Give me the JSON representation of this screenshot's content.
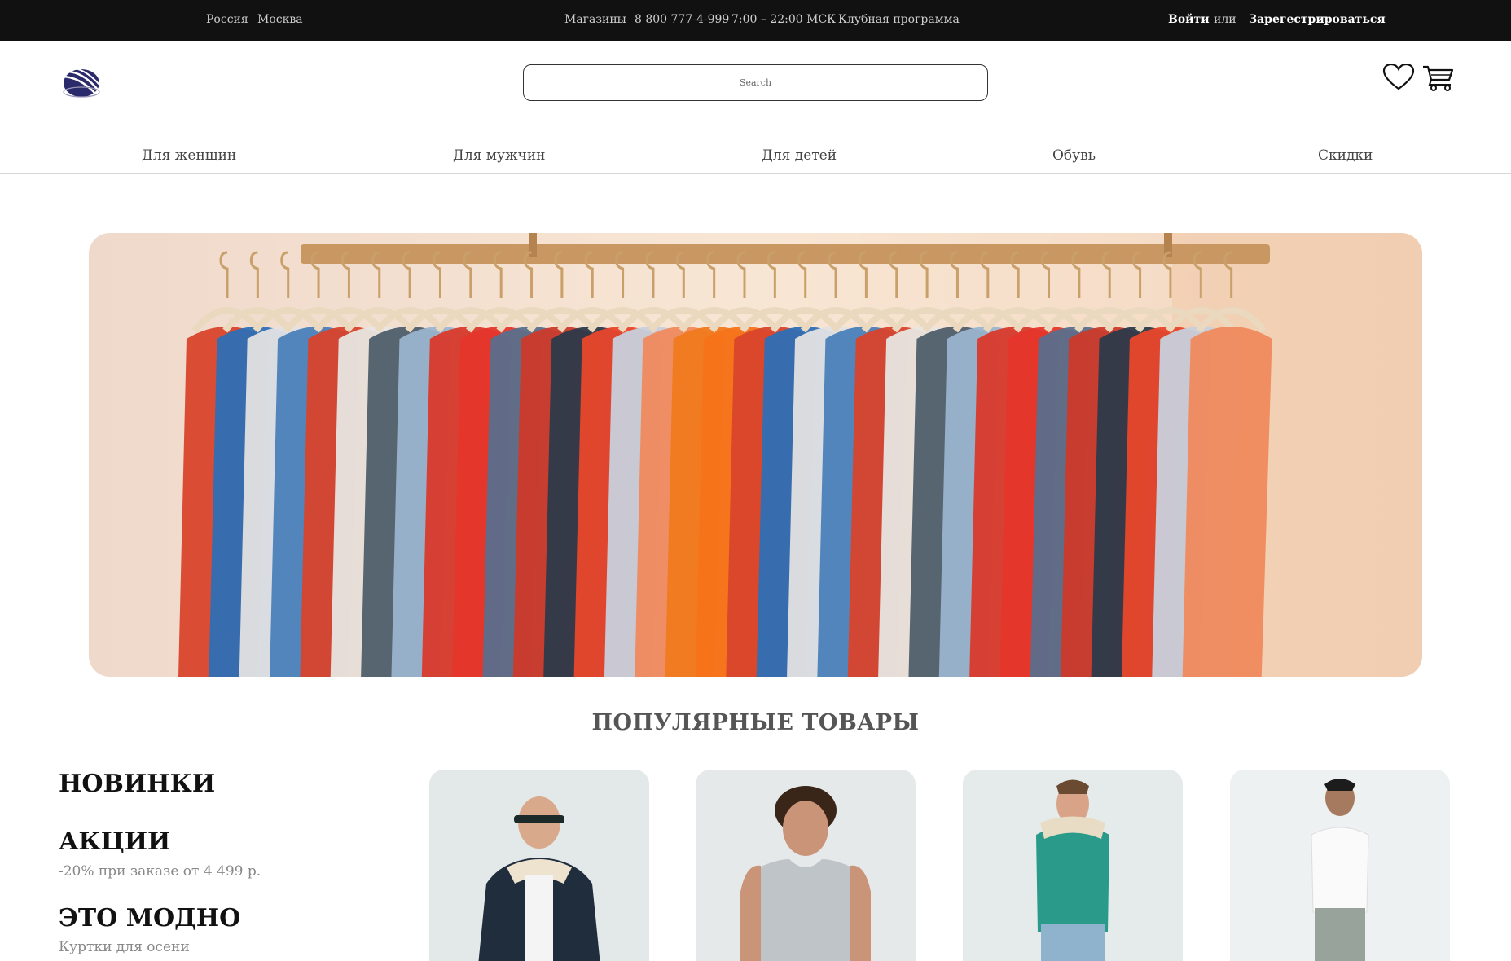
{
  "topbar": {
    "country": "Россия",
    "city": "Москва",
    "stores": "Магазины",
    "phone": "8 800 777-4-999",
    "hours": "7:00 – 22:00 МСК",
    "club": "Клубная программа",
    "login": "Войти",
    "or": "или",
    "register": "Зарегестрироваться"
  },
  "header": {
    "search_placeholder": "Search",
    "icons": [
      "logo-icon",
      "heart-icon",
      "cart-icon"
    ]
  },
  "nav": {
    "items": [
      "Для женщин",
      "Для мужчин",
      "Для детей",
      "Обувь",
      "Скидки"
    ]
  },
  "popular": {
    "title": "ПОПУЛЯРНЫЕ ТОВАРЫ",
    "categories": [
      {
        "title": "НОВИНКИ",
        "subtitle": ""
      },
      {
        "title": "АКЦИИ",
        "subtitle": "-20% при заказе от 4 499 р."
      },
      {
        "title": "ЭТО МОДНО",
        "subtitle": "Куртки для осени"
      }
    ]
  },
  "colors": {
    "topbar_bg": "#111111",
    "accent_logo": "#2b2a6b"
  }
}
